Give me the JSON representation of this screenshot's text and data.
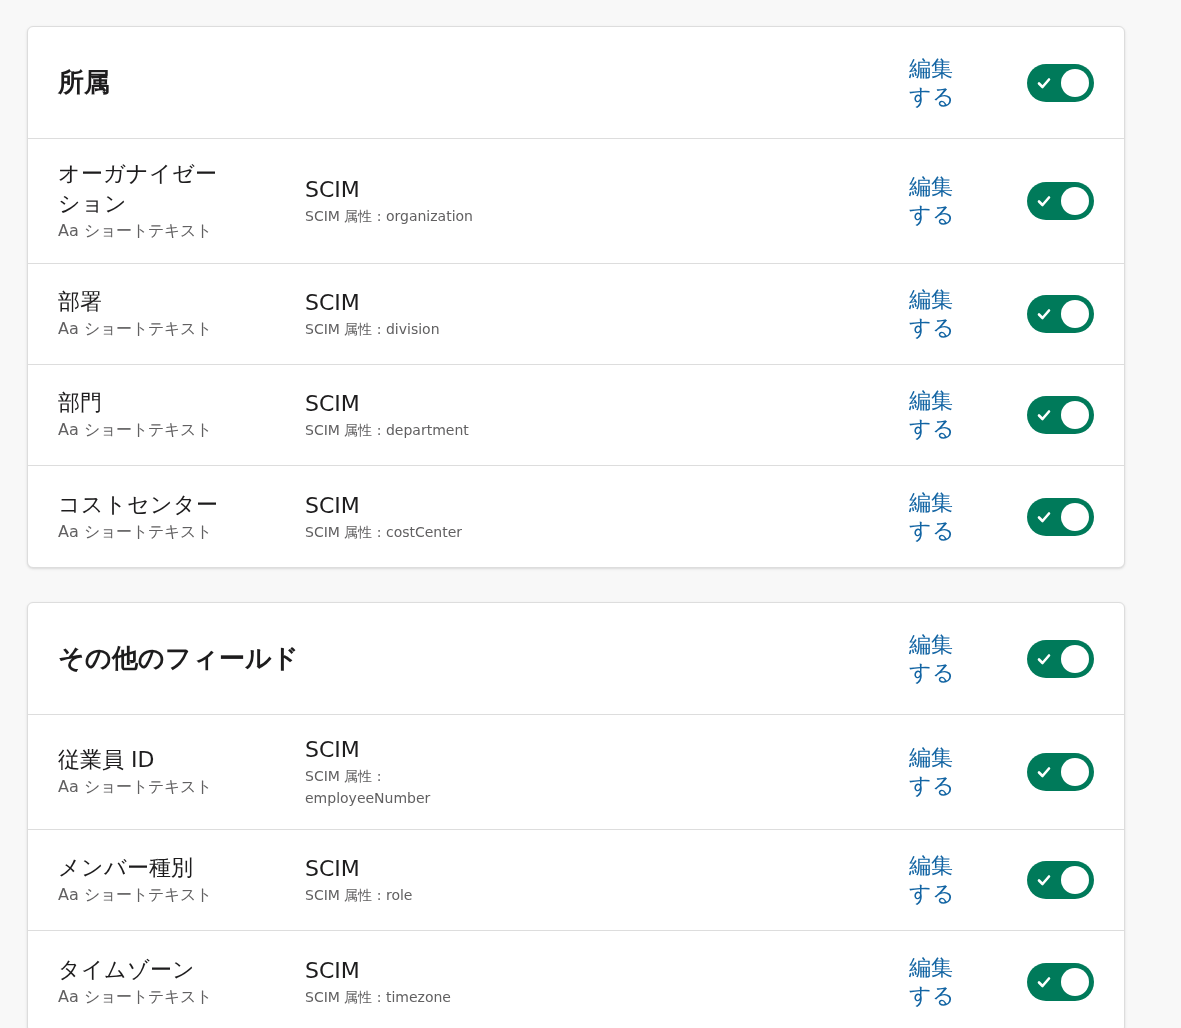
{
  "sections": [
    {
      "title": "所属",
      "edit_label": "編集する",
      "enabled": true,
      "fields": [
        {
          "name": "オーガナイゼーション",
          "type_label": "Aa ショートテキスト",
          "source": "SCIM",
          "attribute": "SCIM 属性 : organization",
          "edit_label": "編集する",
          "enabled": true
        },
        {
          "name": "部署",
          "type_label": "Aa ショートテキスト",
          "source": "SCIM",
          "attribute": "SCIM 属性 : division",
          "edit_label": "編集する",
          "enabled": true
        },
        {
          "name": "部門",
          "type_label": "Aa ショートテキスト",
          "source": "SCIM",
          "attribute": "SCIM 属性 : department",
          "edit_label": "編集する",
          "enabled": true
        },
        {
          "name": "コストセンター",
          "type_label": "Aa ショートテキスト",
          "source": "SCIM",
          "attribute": "SCIM 属性 : costCenter",
          "edit_label": "編集する",
          "enabled": true
        }
      ]
    },
    {
      "title": "その他のフィールド",
      "edit_label": "編集する",
      "enabled": true,
      "fields": [
        {
          "name": "従業員 ID",
          "type_label": "Aa ショートテキスト",
          "source": "SCIM",
          "attribute": "SCIM 属性 : employeeNumber",
          "edit_label": "編集する",
          "enabled": true
        },
        {
          "name": "メンバー種別",
          "type_label": "Aa ショートテキスト",
          "source": "SCIM",
          "attribute": "SCIM 属性 : role",
          "edit_label": "編集する",
          "enabled": true
        },
        {
          "name": "タイムゾーン",
          "type_label": "Aa ショートテキスト",
          "source": "SCIM",
          "attribute": "SCIM 属性 : timezone",
          "edit_label": "編集する",
          "enabled": true
        }
      ]
    }
  ]
}
